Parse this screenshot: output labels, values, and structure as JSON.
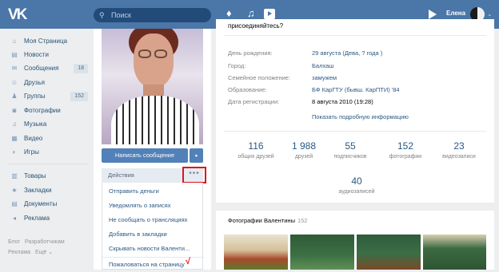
{
  "topbar": {
    "logo": "VK",
    "search_placeholder": "Поиск",
    "user_name": "Елена"
  },
  "sidebar": {
    "items": [
      {
        "icon": "home-icon",
        "glyph": "⌂",
        "label": "Моя Страница",
        "count": ""
      },
      {
        "icon": "news-icon",
        "glyph": "▤",
        "label": "Новости",
        "count": ""
      },
      {
        "icon": "messages-icon",
        "glyph": "✉",
        "label": "Сообщения",
        "count": "18"
      },
      {
        "icon": "friends-icon",
        "glyph": "☺",
        "label": "Друзья",
        "count": ""
      },
      {
        "icon": "groups-icon",
        "glyph": "♟",
        "label": "Группы",
        "count": "152"
      },
      {
        "icon": "photos-icon",
        "glyph": "◙",
        "label": "Фотографии",
        "count": ""
      },
      {
        "icon": "music-icon",
        "glyph": "♫",
        "label": "Музыка",
        "count": ""
      },
      {
        "icon": "video-icon",
        "glyph": "▦",
        "label": "Видео",
        "count": ""
      },
      {
        "icon": "games-icon",
        "glyph": "◐",
        "label": "Игры",
        "count": ""
      }
    ],
    "items2": [
      {
        "icon": "goods-icon",
        "glyph": "▥",
        "label": "Товары"
      },
      {
        "icon": "bookmarks-icon",
        "glyph": "★",
        "label": "Закладки"
      },
      {
        "icon": "documents-icon",
        "glyph": "▤",
        "label": "Документы"
      },
      {
        "icon": "ads-icon",
        "glyph": "◂",
        "label": "Реклама"
      }
    ],
    "footer": {
      "blog": "Блог",
      "developers": "Разработчикам",
      "ads": "Реклама",
      "more": "Ещё ⌄"
    }
  },
  "profile": {
    "send_message": "Написать сообщение",
    "actions_label": "Действия",
    "more": "•••",
    "menu": [
      "Отправить деньги",
      "Уведомлять о записях",
      "Не сообщать о трансляциях",
      "Добавить в закладки",
      "Скрывать новости Валенти...",
      "Пожаловаться на страницу"
    ],
    "checkmark": "√"
  },
  "info": {
    "intro": "присоединяйтесь?",
    "rows": [
      {
        "key": "День рождения:",
        "value": "29 августа (Дева, ? года )",
        "link": true
      },
      {
        "key": "Город:",
        "value": "Балхаш",
        "link": true
      },
      {
        "key": "Семейное положение:",
        "value": "замужем",
        "link": true
      },
      {
        "key": "Образование:",
        "value": "БФ КарГТУ (бывш. КарПТИ) '84",
        "link": true
      },
      {
        "key": "Дата регистрации:",
        "value": "8 августа 2010 (19:28)",
        "link": false
      }
    ],
    "show_more": "Показать подробную информацию",
    "stats": [
      {
        "num": "116",
        "label": "общих друзей"
      },
      {
        "num": "1 988",
        "label": "друзей"
      },
      {
        "num": "55",
        "label": "подписчиков"
      },
      {
        "num": "152",
        "label": "фотографии"
      },
      {
        "num": "23",
        "label": "видеозаписи"
      }
    ],
    "stats2": {
      "num": "40",
      "label": "аудиозаписей"
    }
  },
  "photos": {
    "title": "Фотографии Валентины",
    "count": "152"
  },
  "colors": {
    "header": "#4a76a8",
    "link": "#2a5885",
    "accent_red": "#e1131b"
  }
}
